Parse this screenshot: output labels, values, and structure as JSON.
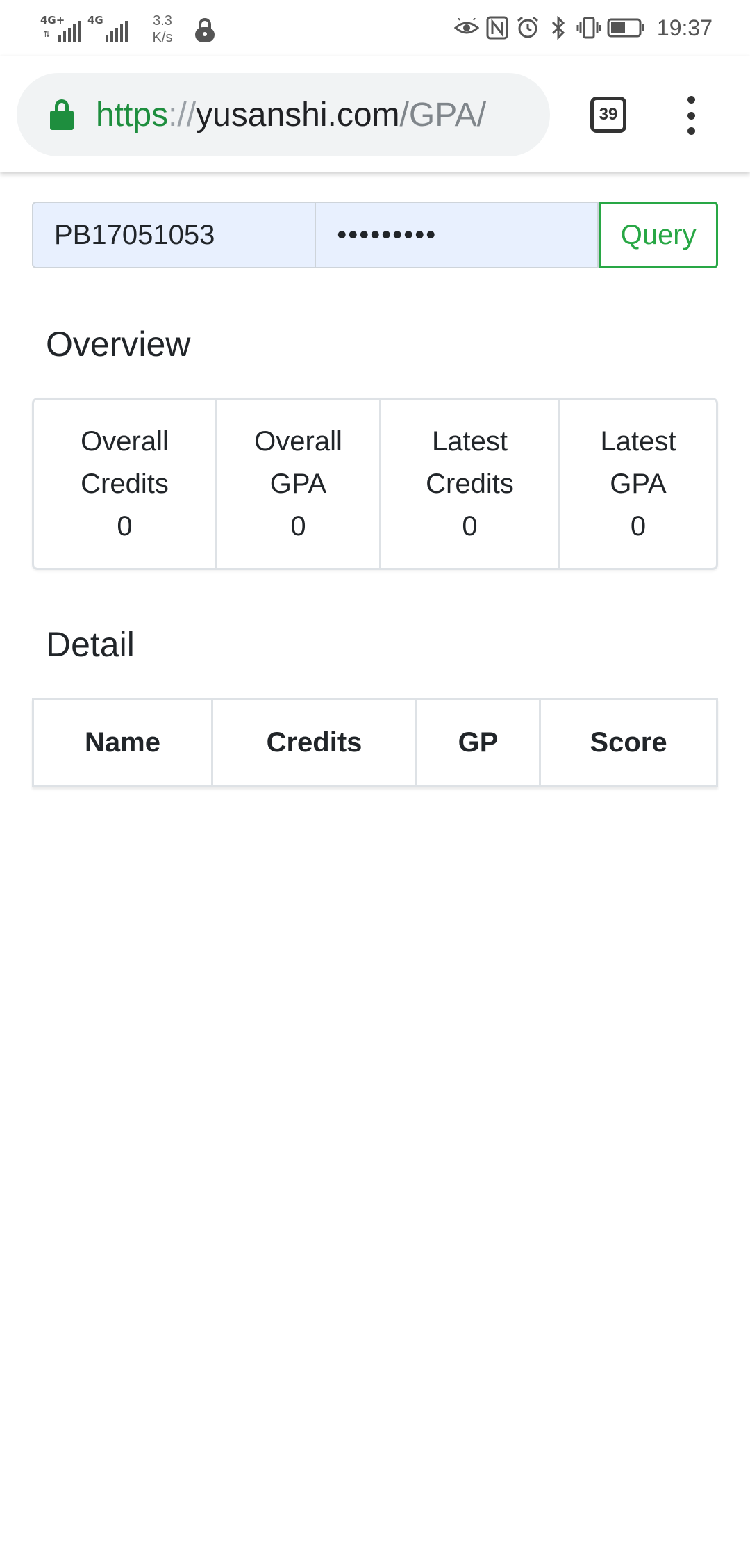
{
  "status_bar": {
    "signal1_label": "4G+",
    "signal2_label": "4G",
    "speed_value": "3.3",
    "speed_unit": "K/s",
    "time": "19:37",
    "icons": [
      "eye-icon",
      "nfc-icon",
      "alarm-icon",
      "bluetooth-icon",
      "vibrate-icon",
      "battery-icon"
    ]
  },
  "browser": {
    "url_scheme": "https",
    "url_separator": "://",
    "url_host": "yusanshi.com",
    "url_path": "/GPA/",
    "tab_count": "39"
  },
  "form": {
    "username": "PB17051053",
    "password_masked": "•••••••••",
    "query_label": "Query"
  },
  "overview": {
    "title": "Overview",
    "cells": [
      {
        "line1": "Overall",
        "line2": "Credits",
        "value": "0"
      },
      {
        "line1": "Overall",
        "line2": "GPA",
        "value": "0"
      },
      {
        "line1": "Latest",
        "line2": "Credits",
        "value": "0"
      },
      {
        "line1": "Latest",
        "line2": "GPA",
        "value": "0"
      }
    ]
  },
  "detail": {
    "title": "Detail",
    "columns": [
      "Name",
      "Credits",
      "GP",
      "Score"
    ]
  },
  "colors": {
    "accent_green": "#28a745",
    "lock_green": "#1e8e3e",
    "autofill_blue": "#e8f0fe",
    "border_gray": "#dee2e6"
  }
}
